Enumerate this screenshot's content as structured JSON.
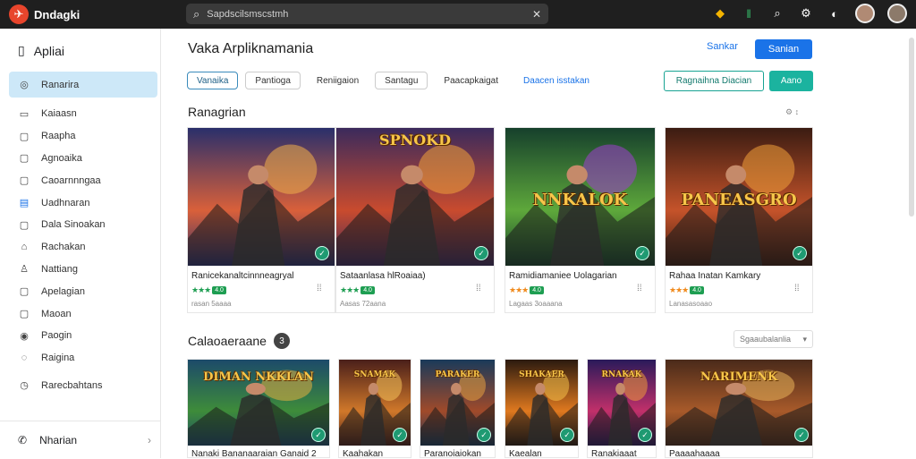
{
  "topbar": {
    "app_name": "Dndagki",
    "search_placeholder": "Sapdscilsmscstmh"
  },
  "sidebar": {
    "title": "Apliai",
    "items": [
      {
        "label": "Ranarira",
        "icon": "compass-icon"
      },
      {
        "label": "Kaiaasn",
        "icon": "tag-icon"
      },
      {
        "label": "Raapha",
        "icon": "page-icon"
      },
      {
        "label": "Agnoaika",
        "icon": "page-icon"
      },
      {
        "label": "Caoarnnngaa",
        "icon": "page-icon"
      },
      {
        "label": "Uadhnaran",
        "icon": "chart-icon"
      },
      {
        "label": "Dala Sinoakan",
        "icon": "page-icon"
      },
      {
        "label": "Rachakan",
        "icon": "home-icon"
      },
      {
        "label": "Nattiang",
        "icon": "user-icon"
      },
      {
        "label": "Apelagian",
        "icon": "page-icon"
      },
      {
        "label": "Maoan",
        "icon": "page-icon"
      },
      {
        "label": "Paogin",
        "icon": "target-icon"
      },
      {
        "label": "Raigina",
        "icon": "globe-icon"
      },
      {
        "label": "Rarecbahtans",
        "icon": "clock-icon"
      }
    ],
    "bottom_label": "Nharian"
  },
  "main": {
    "title": "Vaka Arpliknamania",
    "cancel_label": "Sankar",
    "primary_label": "Sanian",
    "chips": [
      "Vanaika",
      "Pantioga",
      "Reniigaion",
      "Santagu",
      "Paacapkaigat",
      "Daacen isstakan"
    ],
    "outline_button": "Ragnaihna Diacian",
    "teal_button": "Aano",
    "section1": "Ranagrian",
    "section2": "Calaoaeraane",
    "section2_badge": "3",
    "sort_label": "Sgaaubalanlia",
    "cards1": [
      {
        "name": "Ranicekanaltcinnneagryal",
        "meta": "rasan 5aaaa",
        "rating": "4.0",
        "thumb_title": ""
      },
      {
        "name": "Sataanlasa hlRoaiaa)",
        "meta": "Aasas 72aana",
        "rating": "4.0",
        "thumb_title": "SPNOKD"
      },
      {
        "name": "Ramidiamaniee Uolagarian",
        "meta": "Lagaas 3oaaana",
        "rating": "4.0",
        "thumb_title": "NNKALOK"
      },
      {
        "name": "Rahaa Inatan Kamkary",
        "meta": "Lanasasoaao",
        "rating": "4.0",
        "thumb_title": "PANEASGRO"
      }
    ],
    "cards2": [
      {
        "name": "Nanaki Bananaaraian Ganaid 2",
        "thumb_title": "DIMAN NKKLAN"
      },
      {
        "name": "Kaahakan",
        "thumb_title": "SNAMAK"
      },
      {
        "name": "Paranoiaiokan",
        "thumb_title": "PARAKER"
      },
      {
        "name": "Kaealan",
        "thumb_title": "SHAKAER"
      },
      {
        "name": "Ranakiaaat",
        "thumb_title": "RNAKAK"
      },
      {
        "name": "Paaaahaaaa",
        "thumb_title": "NARIMENK"
      }
    ]
  },
  "colors": {
    "topbar": "#1f1f1f",
    "accent_blue": "#1a73e8",
    "accent_teal": "#1bb39f",
    "sidebar_active": "#cde8f8"
  }
}
